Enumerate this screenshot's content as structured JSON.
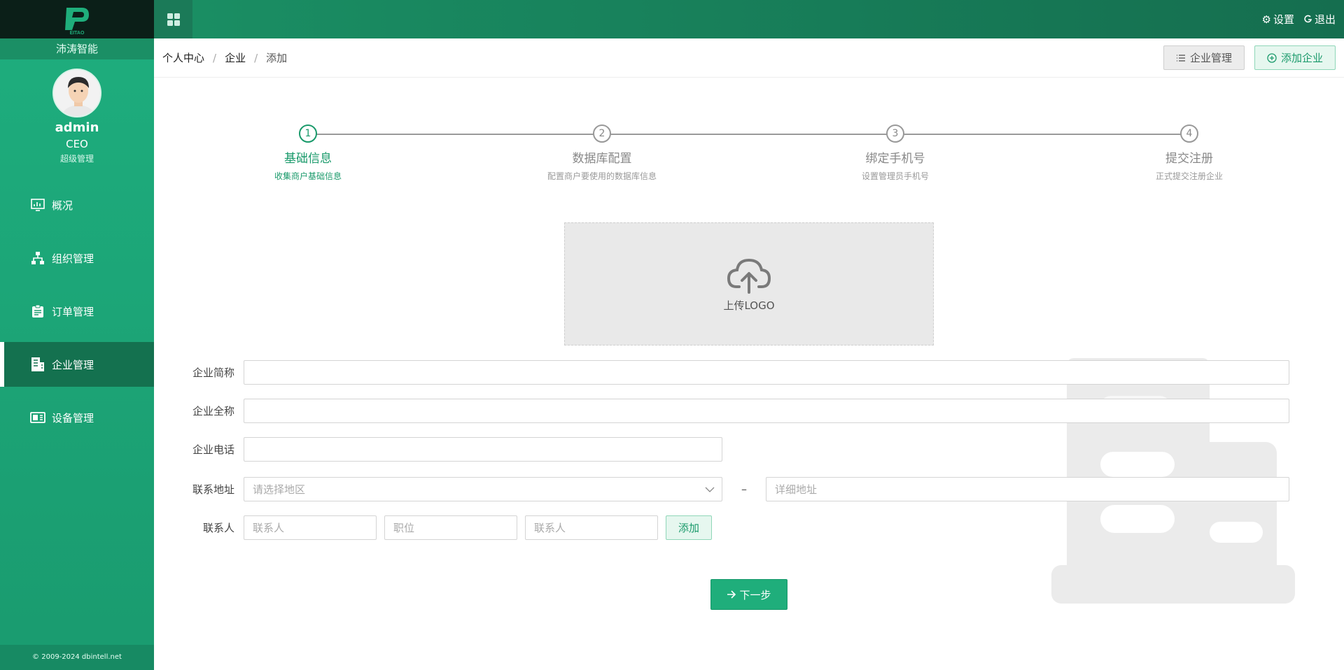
{
  "app": {
    "brand": "沛涛智能",
    "logo_text": "EITAO"
  },
  "user": {
    "name": "admin",
    "title": "CEO",
    "level": "超级管理"
  },
  "sidebar": {
    "items": [
      {
        "label": "概况",
        "icon": "chart-icon"
      },
      {
        "label": "组织管理",
        "icon": "org-icon"
      },
      {
        "label": "订单管理",
        "icon": "clipboard-icon"
      },
      {
        "label": "企业管理",
        "icon": "building-icon",
        "active": true
      },
      {
        "label": "设备管理",
        "icon": "device-icon"
      }
    ],
    "footer": "© 2009-2024 dbintell.net"
  },
  "topbar": {
    "settings": "设置",
    "logout": "退出"
  },
  "breadcrumb": {
    "items": [
      "个人中心",
      "企业",
      "添加"
    ]
  },
  "header_buttons": {
    "manage": "企业管理",
    "add": "添加企业"
  },
  "steps": [
    {
      "num": "1",
      "title": "基础信息",
      "desc": "收集商户基础信息",
      "active": true
    },
    {
      "num": "2",
      "title": "数据库配置",
      "desc": "配置商户要使用的数据库信息"
    },
    {
      "num": "3",
      "title": "绑定手机号",
      "desc": "设置管理员手机号"
    },
    {
      "num": "4",
      "title": "提交注册",
      "desc": "正式提交注册企业"
    }
  ],
  "upload": {
    "label": "上传LOGO"
  },
  "form": {
    "short_name": {
      "label": "企业简称",
      "value": ""
    },
    "full_name": {
      "label": "企业全称",
      "value": ""
    },
    "phone": {
      "label": "企业电话",
      "value": ""
    },
    "address": {
      "label": "联系地址",
      "region_placeholder": "请选择地区",
      "separator": "–",
      "detail_placeholder": "详细地址"
    },
    "contact": {
      "label": "联系人",
      "name_placeholder": "联系人",
      "position_placeholder": "职位",
      "phone_placeholder": "联系人",
      "add_button": "添加"
    }
  },
  "next_button": "下一步",
  "colors": {
    "primary": "#1fae7b",
    "sidebar": "#1eae7e",
    "active_item": "#14714f",
    "topbar": "#156e4f"
  }
}
